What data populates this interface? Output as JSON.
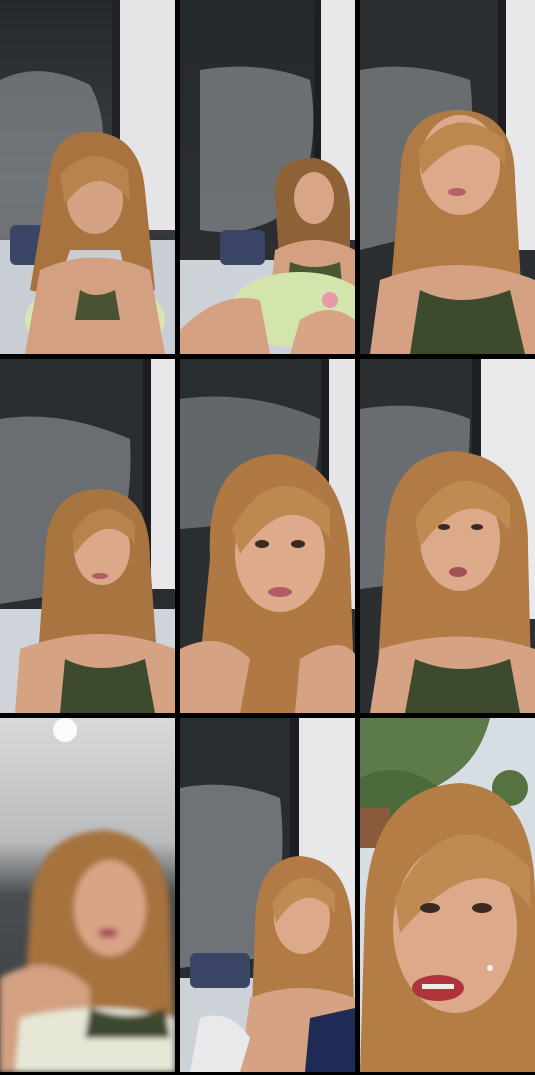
{
  "collage": {
    "rows": 3,
    "columns": 3,
    "frames": [
      {
        "subject": "woman-looking-down",
        "scene": "dark-wall-room",
        "blur": false
      },
      {
        "subject": "woman-leaning-on-pillow",
        "scene": "dark-wall-room",
        "blur": false
      },
      {
        "subject": "woman-close-speaking",
        "scene": "dark-wall-room",
        "blur": false
      },
      {
        "subject": "woman-facing-camera",
        "scene": "dark-wall-room",
        "blur": false
      },
      {
        "subject": "woman-closeup",
        "scene": "dark-wall-room",
        "blur": false
      },
      {
        "subject": "woman-speaking",
        "scene": "dark-wall-room",
        "blur": false
      },
      {
        "subject": "woman-blurred-motion",
        "scene": "ceiling-light",
        "blur": true
      },
      {
        "subject": "woman-sitting",
        "scene": "dark-wall-room",
        "blur": false
      },
      {
        "subject": "woman-outdoor-closeup",
        "scene": "outdoor-trees",
        "blur": false
      }
    ],
    "colors": {
      "background": "#000000",
      "wall_dark": "#2a2d31",
      "wall_light": "#b9bcbf",
      "curtain": "#e6e6e8",
      "hair": "#b07a45",
      "skin": "#d9a688",
      "top_green": "#3e4a2e"
    }
  }
}
